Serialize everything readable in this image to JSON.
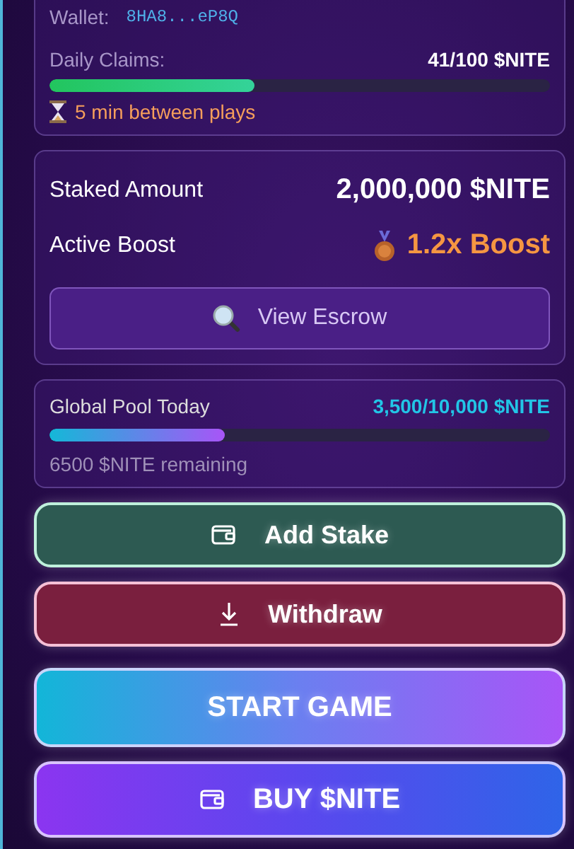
{
  "wallet": {
    "label": "Wallet:",
    "address": "8HA8...eP8Q"
  },
  "daily_claims": {
    "label": "Daily Claims:",
    "value": "41/100 $NITE",
    "level": 0.41
  },
  "cooldown": "5 min between plays",
  "stake": {
    "staked_label": "Staked Amount",
    "staked_value": "2,000,000 $NITE",
    "boost_label": "Active Boost",
    "boost_value": "1.2x Boost",
    "view_button": "View Escrow"
  },
  "global_pool": {
    "label": "Global Pool Today",
    "value": "3,500/10,000 $NITE",
    "level": 0.35,
    "remaining": "6500 $NITE remaining"
  },
  "buttons": [
    {
      "kind": "stake",
      "label": "Add Stake"
    },
    {
      "kind": "withdraw",
      "label": "Withdraw"
    },
    {
      "kind": "start",
      "label": "START GAME"
    },
    {
      "kind": "buy",
      "label": "BUY $NITE"
    }
  ]
}
